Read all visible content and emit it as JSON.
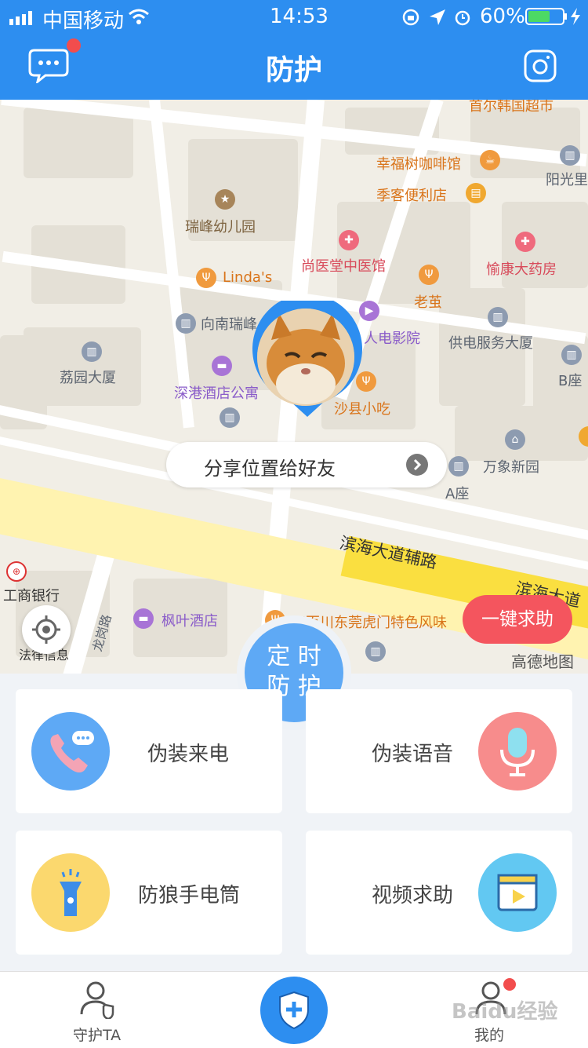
{
  "status_bar": {
    "carrier": "中国移动",
    "time": "14:53",
    "battery": "60%"
  },
  "header": {
    "title": "防护"
  },
  "map": {
    "pois": {
      "korean_market": "首尔韩国超市",
      "cafe": "幸福树咖啡馆",
      "store": "季客便利店",
      "yangguang": "阳光里",
      "kindergarten": "瑞峰幼儿园",
      "tcm": "尚医堂中医馆",
      "pharmacy": "愉康大药房",
      "lindas": "Linda's",
      "laoying": "老茧",
      "xiangnan": "向南瑞峰",
      "cinema": "人电影院",
      "power": "供电服务大厦",
      "ligarden": "荔园大厦",
      "bseat": "B座",
      "apartment": "深港酒店公寓",
      "shaxian": "沙县小吃",
      "wanxiang": "万象新园",
      "aseat": "A座",
      "road_aux": "滨海大道辅路",
      "road_main": "滨海大道",
      "icbc": "工商银行",
      "fengye": "枫叶酒店",
      "restaurant": "聚百川东莞虎门特色风味",
      "longgang": "龙岗路",
      "court": "法律信息",
      "amap": "高德地图"
    },
    "share_label": "分享位置给好友",
    "sos_label": "一键求助"
  },
  "timer_button": {
    "line1": "定 时",
    "line2": "防 护"
  },
  "features": {
    "fake_call": "伪装来电",
    "fake_voice": "伪装语音",
    "flashlight": "防狼手电筒",
    "video_help": "视频求助"
  },
  "nav": {
    "guard": "守护TA",
    "mine": "我的"
  },
  "watermark": "Baidu经验"
}
